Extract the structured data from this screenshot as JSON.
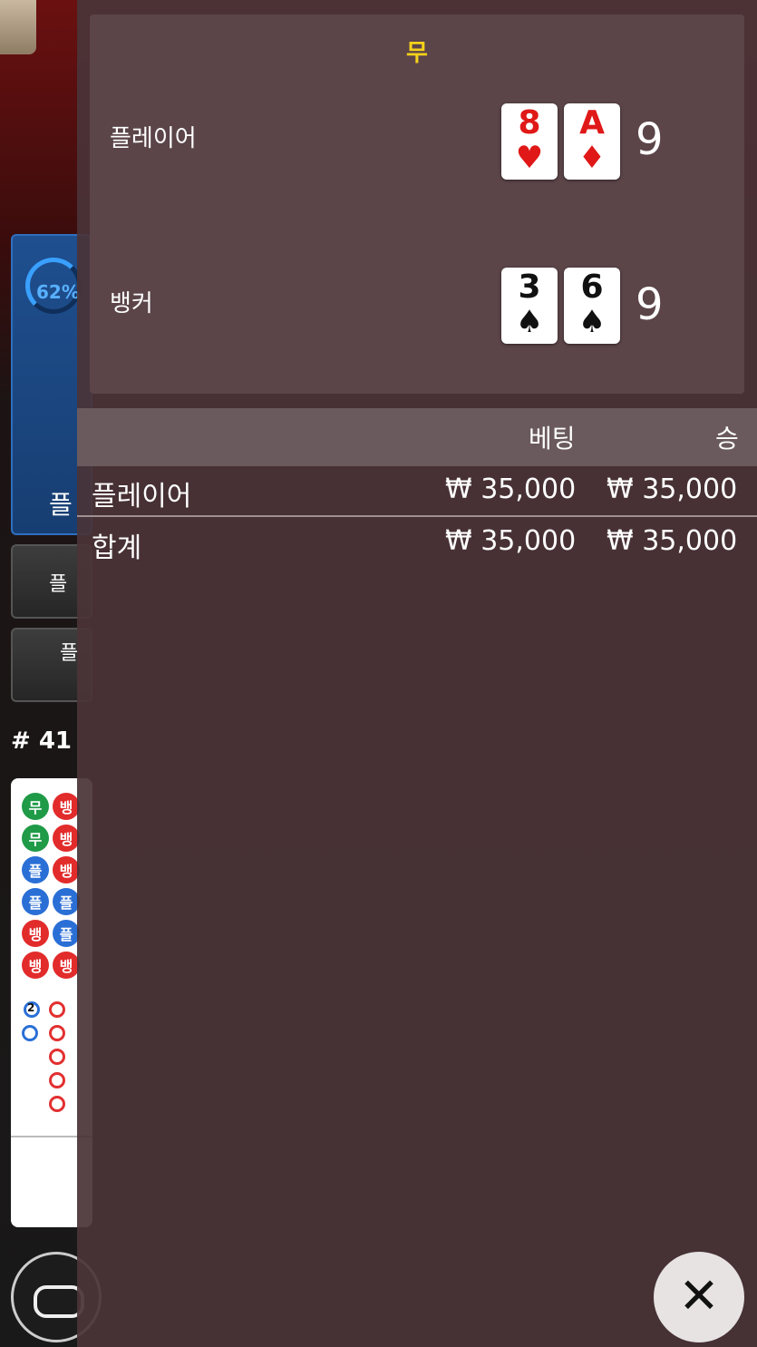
{
  "game": {
    "timer_percent": "62%",
    "timer_label": "플",
    "side_button_1": "플",
    "side_button_2": "플",
    "round_number": "# 41",
    "bead_road": [
      [
        "무",
        "뱅"
      ],
      [
        "무",
        "뱅"
      ],
      [
        "플",
        "뱅"
      ],
      [
        "플",
        "플"
      ],
      [
        "뱅",
        "플"
      ],
      [
        "뱅",
        "뱅"
      ]
    ],
    "bead_badge": "2"
  },
  "result": {
    "outcome": "무",
    "player": {
      "label": "플레이어",
      "cards": [
        {
          "rank": "8",
          "suit": "♥",
          "color": "red"
        },
        {
          "rank": "A",
          "suit": "♦",
          "color": "red"
        }
      ],
      "total": "9"
    },
    "banker": {
      "label": "뱅커",
      "cards": [
        {
          "rank": "3",
          "suit": "♠",
          "color": "black"
        },
        {
          "rank": "6",
          "suit": "♠",
          "color": "black"
        }
      ],
      "total": "9"
    }
  },
  "bets": {
    "header_bet": "베팅",
    "header_win": "승",
    "rows": [
      {
        "label": "플레이어",
        "bet": "₩ 35,000",
        "win": "₩ 35,000"
      }
    ],
    "total": {
      "label": "합계",
      "bet": "₩ 35,000",
      "win": "₩ 35,000"
    }
  },
  "close_icon": "close-icon",
  "chat_icon": "chat-icon",
  "colors": {
    "outcome": "#f5d21a",
    "overlay": "#4a3438",
    "card_red": "#e01818"
  }
}
